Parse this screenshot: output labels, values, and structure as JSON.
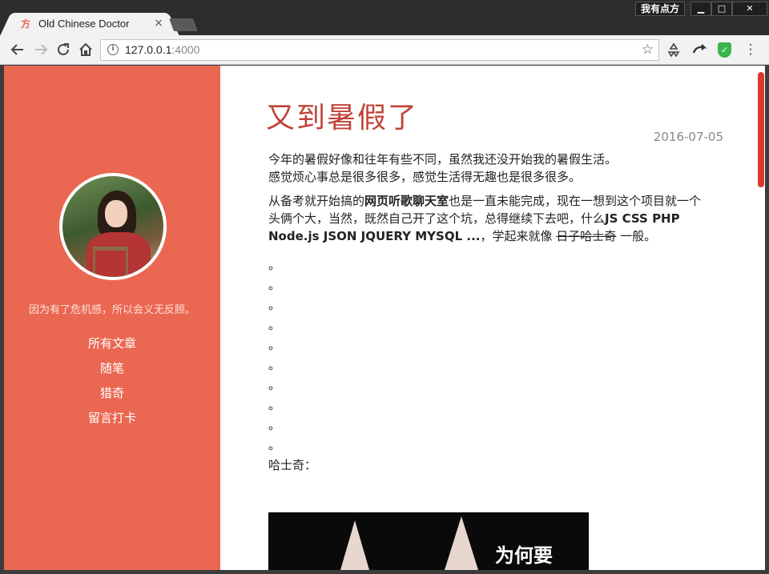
{
  "browser": {
    "tab_title": "Old Chinese Doctor",
    "tab_favicon": "方",
    "tab_close": "×",
    "profile_label": "我有点方",
    "window_minimize": "▁",
    "window_maximize": "□",
    "window_close": "✕",
    "url_host": "127.0.0.1",
    "url_port": ":4000",
    "icons": {
      "back": "arrow-left-icon",
      "forward": "arrow-right-icon",
      "reload": "reload-icon",
      "home": "home-icon",
      "info": "info-icon",
      "bookmark": "star-icon",
      "ext1": "recycle-icon",
      "ext2": "send-icon",
      "ext3": "shield-icon",
      "menu": "menu-icon"
    }
  },
  "sidebar": {
    "accent_color": "#ea6752",
    "motto": "因为有了危机感，所以会义无反顾。",
    "nav": [
      {
        "label": "所有文章"
      },
      {
        "label": "随笔"
      },
      {
        "label": "猎奇"
      },
      {
        "label": "留言打卡"
      }
    ]
  },
  "post": {
    "title": "又到暑假了",
    "date": "2016-07-05",
    "p1_line1": "今年的暑假好像和往年有些不同，虽然我还没开始我的暑假生活。",
    "p1_line2": "感觉烦心事总是很多很多，感觉生活得无趣也是很多很多。",
    "p2_a": "从备考就开始搞的",
    "p2_bold1": "网页听歌聊天室",
    "p2_b": "也是一直未能完成，现在一想到这个项目就一个头俩个大，当然，既然自己开了这个坑，总得继续下去吧，什么",
    "p2_bold2": "JS CSS PHP Node.js JSON JQUERY MYSQL ...",
    "p2_c": "，学起来就像",
    "p2_strike": "日子哈士奇",
    "p2_d": "一般。",
    "dots": [
      "。",
      "。",
      "。",
      "。",
      "。",
      "。",
      "。",
      "。",
      "。",
      "。"
    ],
    "husky_label": "哈士奇：",
    "image_caption": "为何要"
  }
}
